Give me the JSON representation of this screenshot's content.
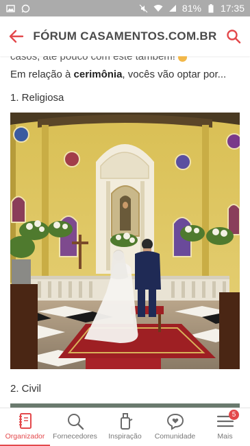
{
  "status_bar": {
    "battery": "81%",
    "time": "17:35",
    "icons": [
      "photo-icon",
      "whatsapp-icon",
      "muted-icon",
      "wifi-icon",
      "signal-icon",
      "battery-icon"
    ]
  },
  "header": {
    "title": "FÓRUM CASAMENTOS.COM.BR",
    "back_icon": "arrow-left-icon",
    "search_icon": "search-icon",
    "accent": "#e3484b"
  },
  "post": {
    "cut_line": "casos, até pouco com este tambem!",
    "question_prefix": "Em relação à ",
    "question_bold": "cerimônia",
    "question_suffix": ", vocês vão optar por...",
    "option_1": "1. Religiosa",
    "option_2": "2. Civil"
  },
  "nav": {
    "items": [
      {
        "label": "Organizador",
        "icon": "notebook-icon",
        "active": true
      },
      {
        "label": "Fornecedores",
        "icon": "search-icon",
        "active": false
      },
      {
        "label": "Inspiração",
        "icon": "bottle-icon",
        "active": false
      },
      {
        "label": "Comunidade",
        "icon": "heart-chat-icon",
        "active": false
      },
      {
        "label": "Mais",
        "icon": "menu-icon",
        "active": false,
        "badge": "5"
      }
    ]
  }
}
